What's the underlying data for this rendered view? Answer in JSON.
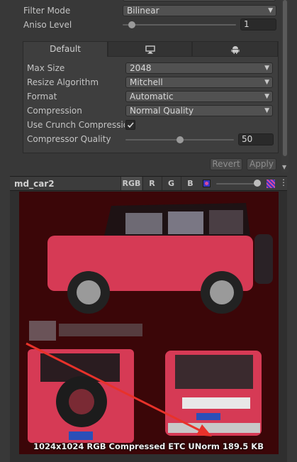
{
  "top_fields": {
    "filter_mode_label": "Filter Mode",
    "filter_mode_value": "Bilinear",
    "aniso_label": "Aniso Level",
    "aniso_value": "1",
    "aniso_fraction": 0.0
  },
  "platform_tabs": [
    {
      "label": "Default",
      "icon": "",
      "selected": true
    },
    {
      "label": "",
      "icon": "monitor-icon",
      "selected": false
    },
    {
      "label": "",
      "icon": "android-icon",
      "selected": false
    }
  ],
  "settings": {
    "max_size_label": "Max Size",
    "max_size_value": "2048",
    "resize_label": "Resize Algorithm",
    "resize_value": "Mitchell",
    "format_label": "Format",
    "format_value": "Automatic",
    "compression_label": "Compression",
    "compression_value": "Normal Quality",
    "crunch_label": "Use Crunch Compression",
    "crunch_checked": true,
    "quality_label": "Compressor Quality",
    "quality_value": "50",
    "quality_fraction": 0.5
  },
  "buttons": {
    "revert": "Revert",
    "apply": "Apply"
  },
  "preview": {
    "asset_name": "md_car2",
    "channels": [
      "RGB",
      "R",
      "G",
      "B"
    ],
    "active_channel": "RGB",
    "info": "1024x1024  RGB Compressed ETC UNorm  189.5 KB"
  },
  "colors": {
    "panel_bg": "#383838",
    "preview_bg": "#3b0608",
    "car_red": "#d63a55",
    "annotation_arrow": "#e8322a"
  }
}
